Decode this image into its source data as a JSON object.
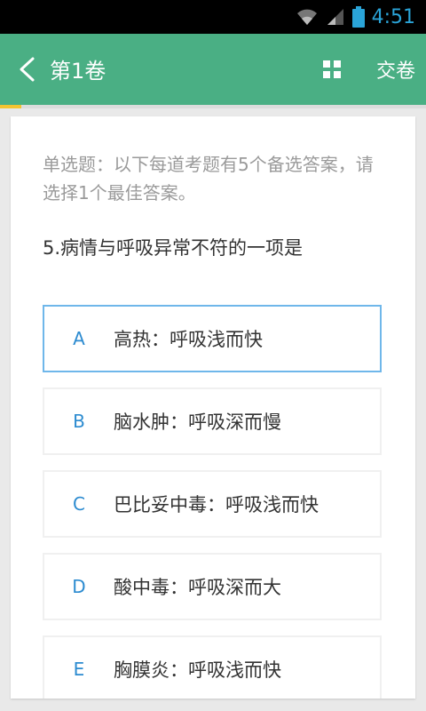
{
  "status_bar": {
    "time": "4:51"
  },
  "app_bar": {
    "title": "第1卷",
    "submit_label": "交卷"
  },
  "progress": {
    "fraction": 0.05,
    "color": "#f4c430"
  },
  "question": {
    "instructions": "单选题：以下每道考题有5个备选答案，请选择1个最佳答案。",
    "stem": "5.病情与呼吸异常不符的一项是",
    "options": [
      {
        "letter": "A",
        "text": "高热：呼吸浅而快",
        "selected": true
      },
      {
        "letter": "B",
        "text": "脑水肿：呼吸深而慢",
        "selected": false
      },
      {
        "letter": "C",
        "text": "巴比妥中毒：呼吸浅而快",
        "selected": false
      },
      {
        "letter": "D",
        "text": "酸中毒：呼吸深而大",
        "selected": false
      },
      {
        "letter": "E",
        "text": "胸膜炎：呼吸浅而快",
        "selected": false
      }
    ]
  },
  "colors": {
    "accent_green": "#4aaf84",
    "option_letter": "#2c8bd0",
    "selected_border": "#6fb7ea"
  }
}
